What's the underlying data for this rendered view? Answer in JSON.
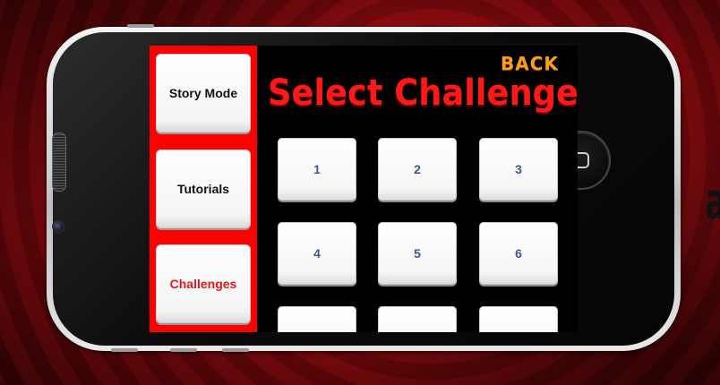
{
  "app": {
    "sidebar": {
      "items": [
        {
          "label": "Story Mode",
          "active": false
        },
        {
          "label": "Tutorials",
          "active": false
        },
        {
          "label": "Challenges",
          "active": true
        }
      ]
    },
    "header": {
      "back_label": "BACK",
      "title": "Select Challenge"
    },
    "challenges": [
      "1",
      "2",
      "3",
      "4",
      "5",
      "6",
      "",
      "",
      ""
    ]
  },
  "colors": {
    "sidebar_bg": "#ff0000",
    "title": "#ff1818",
    "back": "#ff9c1a",
    "active_item": "#e8141a",
    "cell_text": "#3b5a8c"
  },
  "icons": {
    "home": "home-button-icon",
    "speaker": "speaker-grille-icon",
    "camera": "front-camera-icon"
  }
}
